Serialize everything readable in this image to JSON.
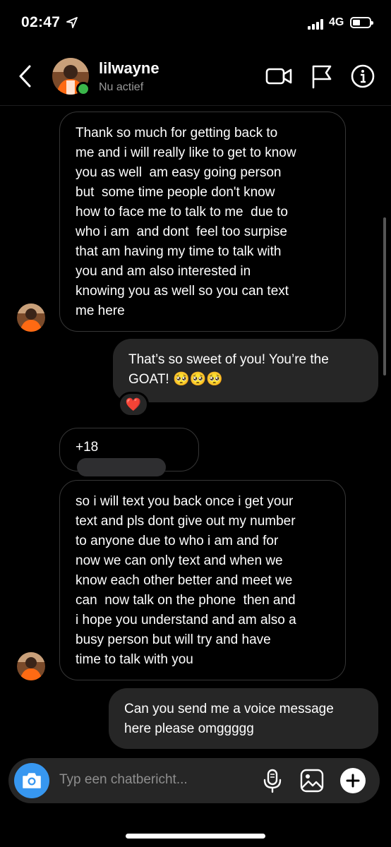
{
  "status_bar": {
    "time": "02:47",
    "network": "4G"
  },
  "header": {
    "name": "lilwayne",
    "status": "Nu actief",
    "icons": [
      "back-chevron-icon",
      "video-camera-icon",
      "flag-icon",
      "info-icon"
    ]
  },
  "messages": [
    {
      "direction": "incoming",
      "lines": [
        "Thank so much for getting back to",
        "me and i will really like to get to know",
        "you as well  am easy going person",
        "but  some time people don't know",
        "how to face me to talk to me  due to",
        "who i am  and dont  feel too surpise",
        "that am having my time to talk with",
        "you and am also interested in",
        "knowing you as well so you can text",
        "me here"
      ]
    },
    {
      "direction": "outgoing",
      "lines": [
        "That’s so sweet of you! You’re the",
        "GOAT! 🥺🥺🥺"
      ],
      "reaction": "❤️"
    },
    {
      "direction": "incoming",
      "text": "+18"
    },
    {
      "direction": "incoming",
      "lines": [
        "so i will text you back once i get your",
        "text and pls dont give out my number",
        "to anyone due to who i am and for",
        "now we can only text and when we",
        "know each other better and meet we",
        "can  now talk on the phone  then and",
        "i hope you understand and am also a",
        "busy person but will try and have",
        "time to talk with you"
      ]
    },
    {
      "direction": "outgoing",
      "lines": [
        "Can you send me a voice message",
        "here please omggggg"
      ]
    }
  ],
  "composer": {
    "placeholder": "Typ een chatbericht...",
    "icons": [
      "camera-icon",
      "microphone-icon",
      "image-icon",
      "plus-icon"
    ],
    "accent_color": "#3797f0"
  },
  "colors": {
    "background": "#000000",
    "outgoing_bubble": "#262626",
    "incoming_border": "#363636",
    "online": "#3ab54a"
  }
}
